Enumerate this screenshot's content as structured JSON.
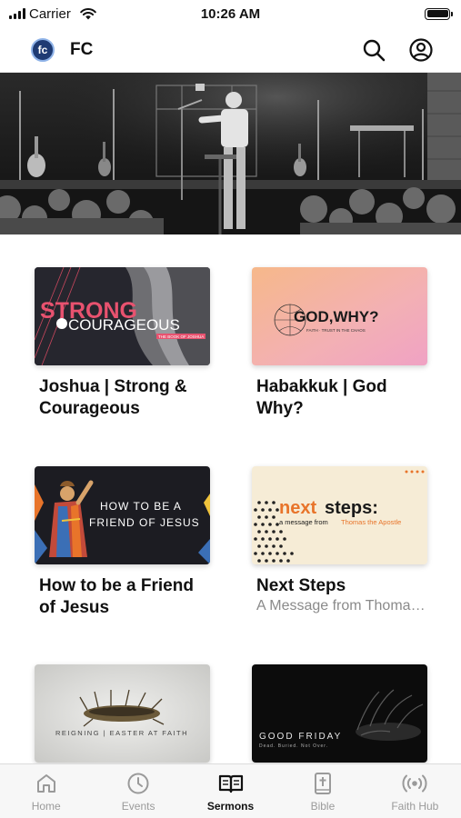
{
  "status_bar": {
    "carrier": "Carrier",
    "time": "10:26 AM"
  },
  "header": {
    "logo_text": "fc",
    "title": "FC"
  },
  "hero": {
    "icon": "stage-photo"
  },
  "cards": [
    {
      "title": "Joshua | Strong & Courageous",
      "subtitle": "",
      "art": {
        "line1": "STRONG",
        "line2": "COURAGEOUS",
        "small": "THE BOOK OF JOSHUA"
      }
    },
    {
      "title": "Habakkuk | God Why?",
      "subtitle": "",
      "art": {
        "line1": "GOD,WHY?",
        "small": "FAITH · TRUST IN THE CHAOS"
      }
    },
    {
      "title": "How to be a Friend of Jesus",
      "subtitle": "",
      "art": {
        "line1": "HOW TO BE A",
        "line2": "FRIEND OF JESUS"
      }
    },
    {
      "title": "Next Steps",
      "subtitle": "A Message from Thomas the Apostle",
      "art": {
        "next": "next",
        "steps": "steps:",
        "small_prefix": "a message from",
        "small_name": "Thomas the Apostle"
      }
    },
    {
      "title": "",
      "subtitle": "",
      "art": {
        "line1": "REIGNING | EASTER AT FAITH"
      }
    },
    {
      "title": "",
      "subtitle": "",
      "art": {
        "line1": "GOOD FRIDAY",
        "small": "Dead. Buried. Not Over."
      }
    }
  ],
  "tabs": [
    {
      "label": "Home",
      "icon": "home-icon",
      "active": false
    },
    {
      "label": "Events",
      "icon": "clock-icon",
      "active": false
    },
    {
      "label": "Sermons",
      "icon": "book-icon",
      "active": true
    },
    {
      "label": "Bible",
      "icon": "bible-icon",
      "active": false
    },
    {
      "label": "Faith Hub",
      "icon": "broadcast-icon",
      "active": false
    }
  ],
  "colors": {
    "accent_pink": "#e8526f",
    "accent_orange": "#e8742a",
    "tab_inactive": "#9a9a9a",
    "tab_active": "#111111"
  }
}
